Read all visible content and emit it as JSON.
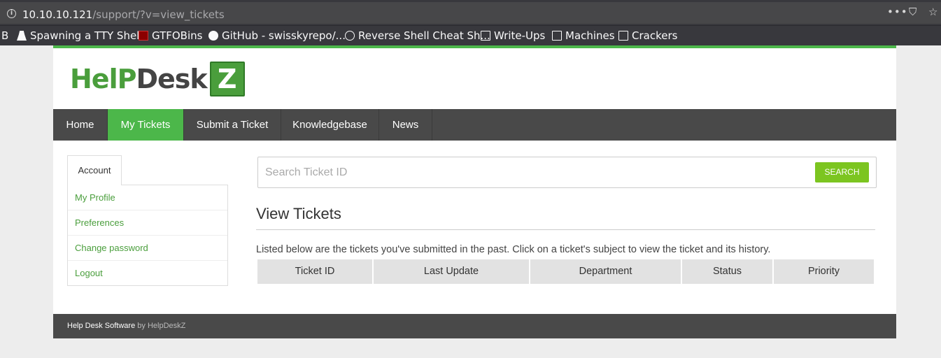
{
  "browser": {
    "url_host": "10.10.10.121",
    "url_path": "/support/?v=view_tickets",
    "actions": {
      "more": "•••",
      "pocket": "⛉",
      "star": "☆"
    },
    "bookmarks": [
      {
        "label": "B",
        "icon": ""
      },
      {
        "label": "Spawning a TTY Shell",
        "icon": "tty-icon"
      },
      {
        "label": "GTFOBins",
        "icon": "gtfobins-icon"
      },
      {
        "label": "GitHub - swisskyrepo/...",
        "icon": "github-icon"
      },
      {
        "label": "Reverse Shell Cheat Sh...",
        "icon": "globe-icon"
      },
      {
        "label": "Write-Ups",
        "icon": "folder-icon"
      },
      {
        "label": "Machines",
        "icon": "folder-icon"
      },
      {
        "label": "Crackers",
        "icon": "folder-icon"
      }
    ]
  },
  "logo": {
    "help": "HelP",
    "desk": "Desk",
    "z": "Z"
  },
  "nav": {
    "items": [
      "Home",
      "My Tickets",
      "Submit a Ticket",
      "Knowledgebase",
      "News"
    ],
    "active": "My Tickets"
  },
  "sidebar": {
    "tab": "Account",
    "links": [
      "My Profile",
      "Preferences",
      "Change password",
      "Logout"
    ]
  },
  "search": {
    "placeholder": "Search Ticket ID",
    "button": "SEARCH"
  },
  "main": {
    "title": "View Tickets",
    "description": "Listed below are the tickets you've submitted in the past. Click on a ticket's subject to view the ticket and its history.",
    "columns": [
      "Ticket ID",
      "Last Update",
      "Department",
      "Status",
      "Priority"
    ]
  },
  "footer": {
    "text": "Help Desk Software",
    "by": " by HelpDeskZ"
  },
  "colors": {
    "accent": "#4cb74a",
    "nav_bg": "#494949",
    "search_button": "#7cc520",
    "link": "#4a9e3c"
  }
}
